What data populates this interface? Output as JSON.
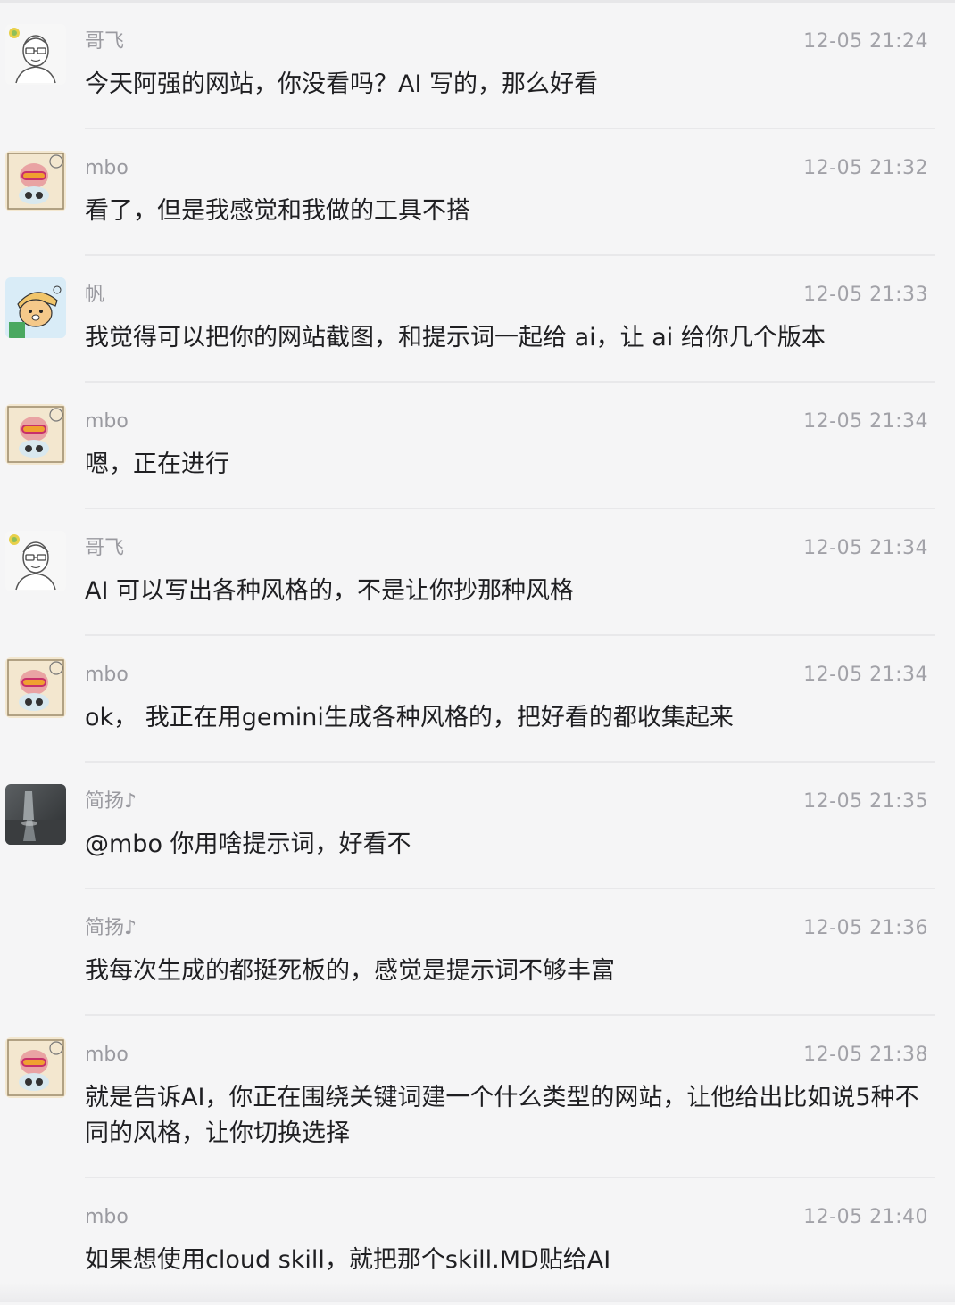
{
  "messages": [
    {
      "sender": "哥飞",
      "time": "12-05 21:24",
      "text": "今天阿强的网站，你没看吗？AI 写的，那么好看",
      "avatar": "gefei-avatar"
    },
    {
      "sender": "mbo",
      "time": "12-05 21:32",
      "text": "看了，但是我感觉和我做的工具不搭",
      "avatar": "mbo-avatar"
    },
    {
      "sender": "帆",
      "time": "12-05 21:33",
      "text": "我觉得可以把你的网站截图，和提示词一起给 ai，让 ai 给你几个版本",
      "avatar": "fan-avatar"
    },
    {
      "sender": "mbo",
      "time": "12-05 21:34",
      "text": "嗯，正在进行",
      "avatar": "mbo-avatar"
    },
    {
      "sender": "哥飞",
      "time": "12-05 21:34",
      "text": "AI 可以写出各种风格的，不是让你抄那种风格",
      "avatar": "gefei-avatar"
    },
    {
      "sender": "mbo",
      "time": "12-05 21:34",
      "text": "ok，  我正在用gemini生成各种风格的，把好看的都收集起来",
      "avatar": "mbo-avatar"
    },
    {
      "sender": "简扬♪",
      "time": "12-05 21:35",
      "text": "@mbo 你用啥提示词，好看不",
      "avatar": "jianyang-avatar"
    },
    {
      "sender": "简扬♪",
      "time": "12-05 21:36",
      "text": "我每次生成的都挺死板的，感觉是提示词不够丰富",
      "avatar": ""
    },
    {
      "sender": "mbo",
      "time": "12-05 21:38",
      "text": "就是告诉AI，你正在围绕关键词建一个什么类型的网站，让他给出比如说5种不同的风格，让你切换选择",
      "avatar": "mbo-avatar"
    },
    {
      "sender": "mbo",
      "time": "12-05 21:40",
      "text": "如果想使用cloud skill，就把那个skill.MD贴给AI",
      "avatar": ""
    }
  ]
}
